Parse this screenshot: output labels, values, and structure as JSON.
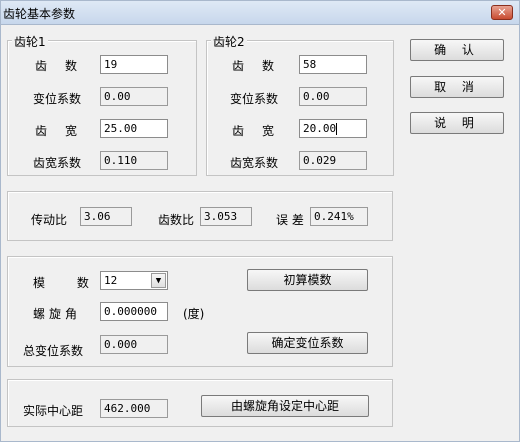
{
  "window": {
    "title": "齿轮基本参数",
    "close": "✕"
  },
  "gear1": {
    "legend": "齿轮1",
    "teeth_label": "齿数",
    "teeth_value": "19",
    "shift_label": "变位系数",
    "shift_value": "0.00",
    "width_label": "齿宽",
    "width_value": "25.00",
    "width_coef_label": "齿宽系数",
    "width_coef_value": "0.110"
  },
  "gear2": {
    "legend": "齿轮2",
    "teeth_label": "齿数",
    "teeth_value": "58",
    "shift_label": "变位系数",
    "shift_value": "0.00",
    "width_label": "齿宽",
    "width_value": "20.00",
    "width_coef_label": "齿宽系数",
    "width_coef_value": "0.029"
  },
  "buttons": {
    "ok": "确 认",
    "cancel": "取 消",
    "help": "说 明"
  },
  "ratio": {
    "trans_label": "传动比",
    "trans_value": "3.06",
    "teeth_ratio_label": "齿数比",
    "teeth_ratio_value": "3.053",
    "error_label": "误 差",
    "error_value": "0.241%"
  },
  "module_group": {
    "module_label": "模 数",
    "module_value": "12",
    "helix_label": "螺旋角",
    "helix_value": "0.000000",
    "helix_unit": "(度)",
    "total_shift_label": "总变位系数",
    "total_shift_value": "0.000",
    "calc_module_btn": "初算模数",
    "set_shift_btn": "确定变位系数"
  },
  "center": {
    "label": "实际中心距",
    "value": "462.000",
    "btn": "由螺旋角设定中心距"
  }
}
